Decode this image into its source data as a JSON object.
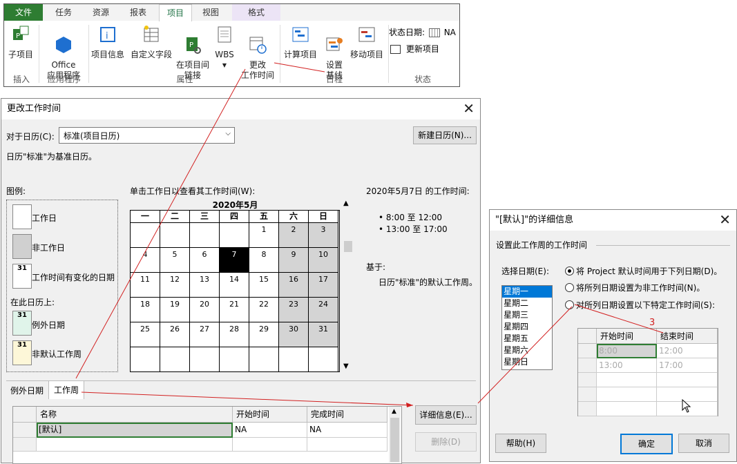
{
  "ribbon": {
    "tabs": [
      "文件",
      "任务",
      "资源",
      "报表",
      "项目",
      "视图",
      "格式"
    ],
    "buttons": {
      "subproject": "子项目",
      "office_apps": "Office\n应用程序",
      "project_info": "项目信息",
      "custom_fields": "自定义字段",
      "links_between": "在项目间\n链接",
      "wbs": "WBS",
      "change_work_time": "更改\n工作时间",
      "calc_project": "计算项目",
      "set_baseline": "设置\n基线",
      "move_project": "移动项目",
      "status_date_label": "状态日期:",
      "status_date_value": "NA",
      "update_project": "更新项目"
    },
    "groups": [
      "插入",
      "应用程序",
      "属性",
      "日程",
      "状态"
    ]
  },
  "change_working_time": {
    "title": "更改工作时间",
    "for_calendar_label": "对于日历(C):",
    "calendar_value": "标准(项目日历)",
    "new_calendar_button": "新建日历(N)...",
    "base_calendar_note": "日历\"标准\"为基准日历。",
    "legend_title": "图例:",
    "legend_working": "工作日",
    "legend_nonworking": "非工作日",
    "legend_changed": "工作时间有变化的日期",
    "legend_on_calendar": "在此日历上:",
    "legend_exception": "例外日期",
    "legend_nondefault_week": "非默认工作周",
    "legend_31": "31",
    "click_hint": "单击工作日以查看其工作时间(W):",
    "month_title": "2020年5月",
    "weekdays": [
      "一",
      "二",
      "三",
      "四",
      "五",
      "六",
      "日"
    ],
    "weeks": [
      [
        "",
        "",
        "",
        "",
        "1",
        "2",
        "3"
      ],
      [
        "4",
        "5",
        "6",
        "7",
        "8",
        "9",
        "10"
      ],
      [
        "11",
        "12",
        "13",
        "14",
        "15",
        "16",
        "17"
      ],
      [
        "18",
        "19",
        "20",
        "21",
        "22",
        "23",
        "24"
      ],
      [
        "25",
        "26",
        "27",
        "28",
        "29",
        "30",
        "31"
      ],
      [
        "",
        "",
        "",
        "",
        "",
        "",
        ""
      ]
    ],
    "selected_day": "7",
    "work_time_heading": "2020年5月7日 的工作时间:",
    "work_times": [
      "• 8:00 至 12:00",
      "• 13:00 至 17:00"
    ],
    "based_on_label": "基于:",
    "based_on_text": "日历\"标准\"的默认工作周。",
    "tab_exceptions": "例外日期",
    "tab_work_weeks": "工作周",
    "table_headers": [
      "名称",
      "开始时间",
      "完成时间"
    ],
    "table_rows": [
      [
        "[默认]",
        "NA",
        "NA"
      ]
    ],
    "details_button": "详细信息(E)...",
    "delete_button": "删除(D)"
  },
  "details_dialog": {
    "title": "\"[默认]\"的详细信息",
    "section_label": "设置此工作周的工作时间",
    "select_days_label": "选择日期(E):",
    "days": [
      "星期一",
      "星期二",
      "星期三",
      "星期四",
      "星期五",
      "星期六",
      "星期日"
    ],
    "radio_default": "将 Project 默认时间用于下列日期(D)。",
    "radio_nonworking": "将所列日期设置为非工作时间(N)。",
    "radio_specific": "对所列日期设置以下特定工作时间(S):",
    "time_headers": [
      "开始时间",
      "结束时间"
    ],
    "time_rows": [
      [
        "8:00",
        "12:00"
      ],
      [
        "13:00",
        "17:00"
      ]
    ],
    "help_button": "帮助(H)",
    "ok_button": "确定",
    "cancel_button": "取消"
  },
  "annotation_label": "3",
  "colors": {
    "file_tab": "#2e7d32",
    "accent": "#217346",
    "annotation": "#d22020",
    "selection": "#0078d7"
  }
}
